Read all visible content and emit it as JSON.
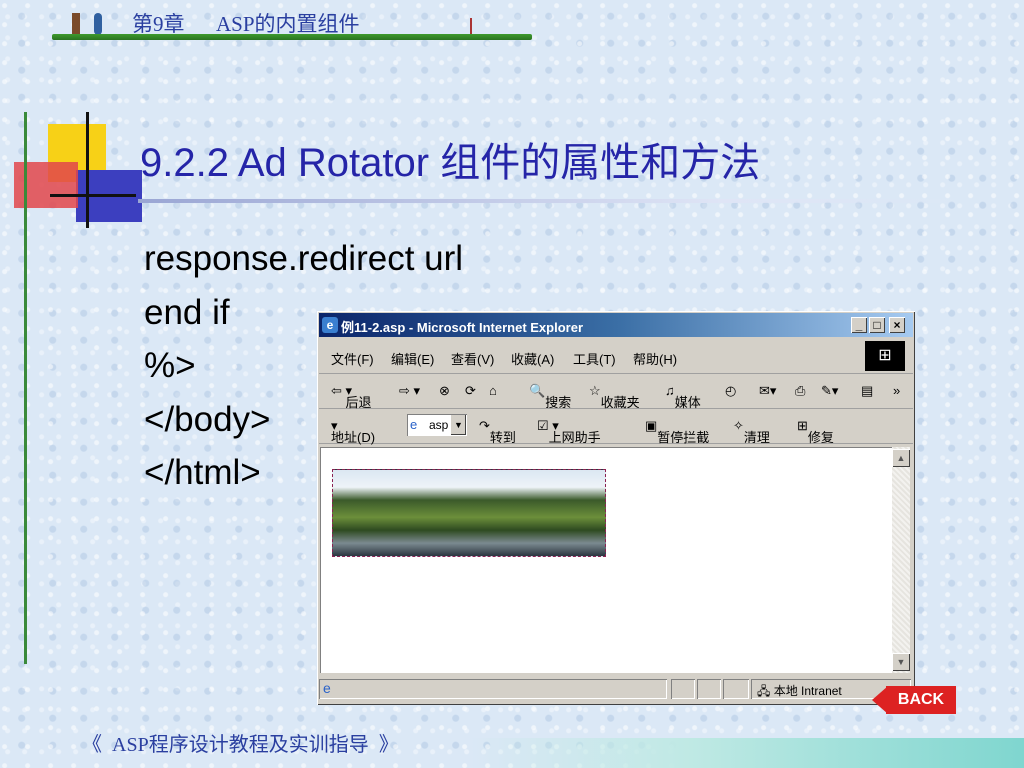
{
  "header": {
    "chapter": "第9章",
    "topic": "ASP的内置组件"
  },
  "slide": {
    "title": "9.2.2  Ad Rotator 组件的属性和方法",
    "code_lines": [
      "response.redirect url",
      "end if",
      "%>",
      "</body>",
      "</html>"
    ]
  },
  "browser": {
    "title": "例11-2.asp - Microsoft Internet Explorer",
    "menu": [
      "文件(F)",
      "编辑(E)",
      "查看(V)",
      "收藏(A)",
      "工具(T)",
      "帮助(H)"
    ],
    "toolbar": [
      "后退",
      "搜索",
      "收藏夹",
      "媒体"
    ],
    "address_label": "地址(D)",
    "address_value": "asp",
    "address_toolbar": [
      "转到",
      "上网助手",
      "暂停拦截",
      "清理",
      "修复"
    ],
    "status_zone": "本地 Intranet"
  },
  "back_button": "BACK",
  "footer": "《  ASP程序设计教程及实训指导  》"
}
